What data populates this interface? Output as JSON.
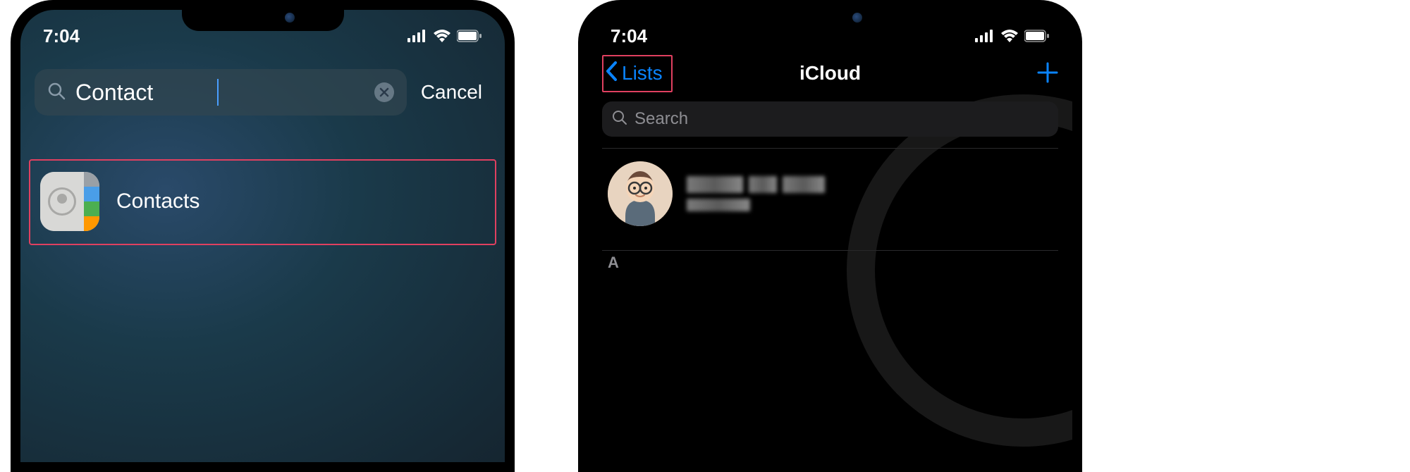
{
  "status": {
    "time": "7:04"
  },
  "screen1": {
    "search_value": "Contact",
    "cancel_label": "Cancel",
    "result_label": "Contacts"
  },
  "screen2": {
    "back_label": "Lists",
    "title": "iCloud",
    "search_placeholder": "Search",
    "section_header": "A"
  }
}
